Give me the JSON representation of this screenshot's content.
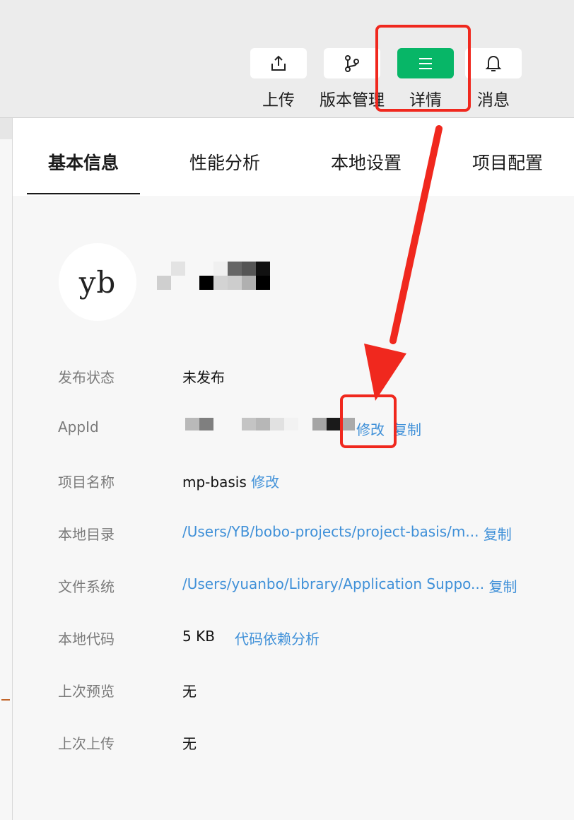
{
  "toolbar": {
    "buttons": [
      {
        "label": "上传",
        "icon": "upload-icon"
      },
      {
        "label": "版本管理",
        "icon": "branch-icon"
      },
      {
        "label": "详情",
        "icon": "menu-icon",
        "active": true
      },
      {
        "label": "消息",
        "icon": "bell-icon"
      }
    ]
  },
  "tabs": [
    "基本信息",
    "性能分析",
    "本地设置",
    "项目配置"
  ],
  "profile": {
    "avatar_text": "yb"
  },
  "info": {
    "publish_status": {
      "label": "发布状态",
      "value": "未发布"
    },
    "appid": {
      "label": "AppId",
      "modify": "修改",
      "copy": "复制"
    },
    "project_name": {
      "label": "项目名称",
      "value": "mp-basis",
      "modify": "修改"
    },
    "local_dir": {
      "label": "本地目录",
      "value": "/Users/YB/bobo-projects/project-basis/m...",
      "copy": "复制"
    },
    "file_system": {
      "label": "文件系统",
      "value": "/Users/yuanbo/Library/Application Suppo...",
      "copy": "复制"
    },
    "local_code": {
      "label": "本地代码",
      "value": "5 KB",
      "link": "代码依赖分析"
    },
    "last_preview": {
      "label": "上次预览",
      "value": "无"
    },
    "last_upload": {
      "label": "上次上传",
      "value": "无"
    }
  },
  "colors": {
    "accent_green": "#07b667",
    "link_blue": "#3f90d8",
    "annotation_red": "#f0281e"
  }
}
